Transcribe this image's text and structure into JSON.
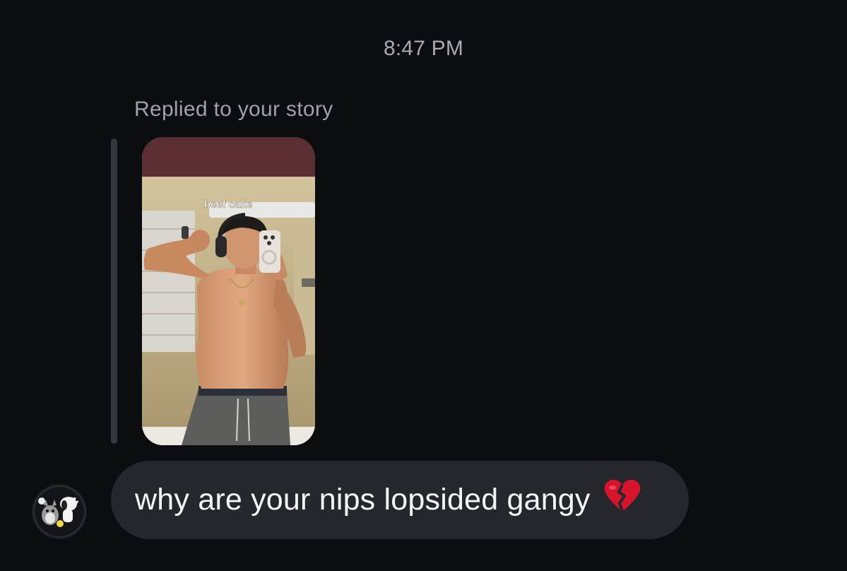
{
  "thread": {
    "timestamp": "8:47 PM",
    "reply_context": "Replied to your story",
    "story": {
      "caption": "beef cake"
    },
    "message": {
      "text": "why are your nips lopsided gangy",
      "emoji": "broken-heart-icon"
    },
    "colors": {
      "background": "#0b0d11",
      "bubble": "#25272c",
      "text": "#f4f5f7",
      "muted": "#a8abb2",
      "emoji_red": "#d8142c"
    }
  }
}
